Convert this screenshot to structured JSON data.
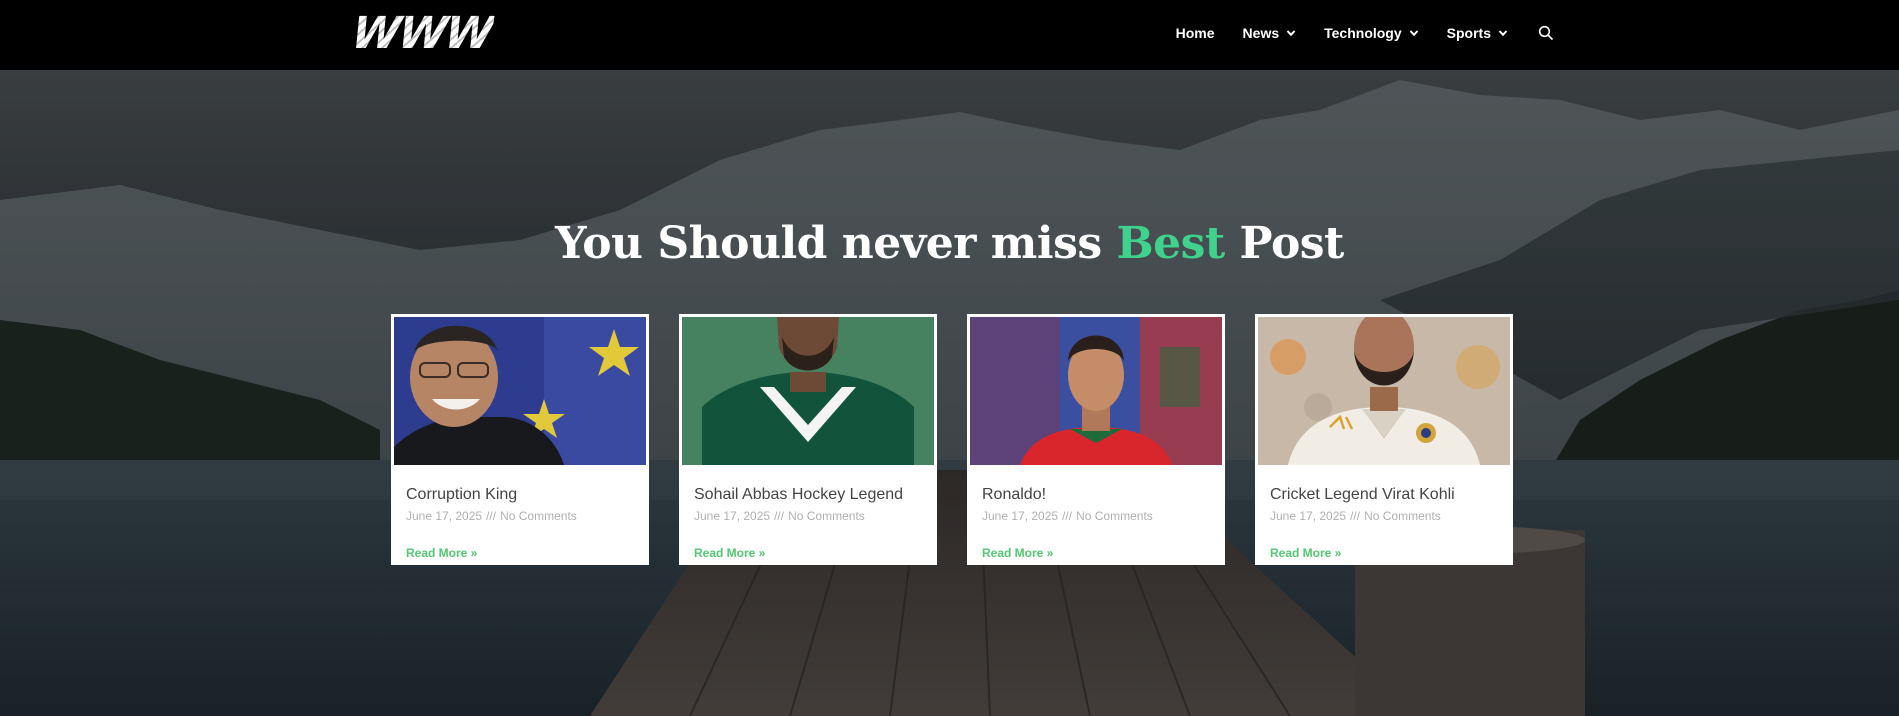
{
  "brand": {
    "logo_text": "WWW"
  },
  "nav": {
    "items": [
      {
        "label": "Home",
        "has_dropdown": false
      },
      {
        "label": "News",
        "has_dropdown": true
      },
      {
        "label": "Technology",
        "has_dropdown": true
      },
      {
        "label": "Sports",
        "has_dropdown": true
      }
    ],
    "search_icon": "search-icon"
  },
  "hero": {
    "heading_before": "You Should never miss ",
    "heading_accent": "Best",
    "heading_after": " Post",
    "accent_color": "#3fd28d"
  },
  "posts": [
    {
      "title": "Corruption King",
      "date": "June 17, 2025",
      "separator": "///",
      "comments": "No Comments",
      "read_more": "Read More »"
    },
    {
      "title": "Sohail Abbas Hockey Legend",
      "date": "June 17, 2025",
      "separator": "///",
      "comments": "No Comments",
      "read_more": "Read More »"
    },
    {
      "title": "Ronaldo!",
      "date": "June 17, 2025",
      "separator": "///",
      "comments": "No Comments",
      "read_more": "Read More »"
    },
    {
      "title": "Cricket Legend Virat Kohli",
      "date": "June 17, 2025",
      "separator": "///",
      "comments": "No Comments",
      "read_more": "Read More »"
    }
  ],
  "colors": {
    "link_green": "#52c774",
    "topbar": "#000000"
  }
}
